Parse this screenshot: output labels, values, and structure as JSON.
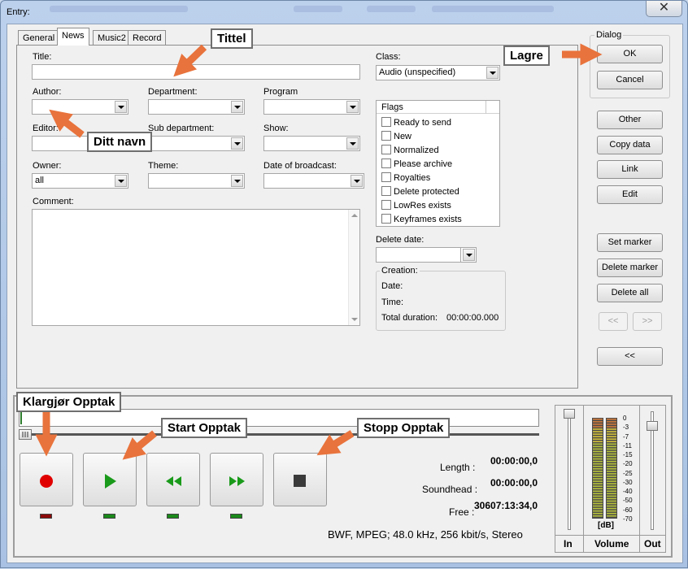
{
  "window": {
    "title": "Entry:",
    "close_symbol": "✕"
  },
  "tabs": [
    {
      "label": "General"
    },
    {
      "label": "News"
    },
    {
      "label": "Music2"
    },
    {
      "label": "Record"
    }
  ],
  "form": {
    "title_label": "Title:",
    "author_label": "Author:",
    "department_label": "Department:",
    "program_label": "Program",
    "editor_label": "Editor:",
    "sub_department_label": "Sub department:",
    "show_label": "Show:",
    "owner_label": "Owner:",
    "owner_value": "all",
    "theme_label": "Theme:",
    "date_of_broadcast_label": "Date of broadcast:",
    "comment_label": "Comment:",
    "class_label": "Class:",
    "class_value": "Audio (unspecified)",
    "flags_header": "Flags",
    "flags": [
      {
        "label": "Ready to send",
        "checked": false
      },
      {
        "label": "New",
        "checked": false
      },
      {
        "label": "Normalized",
        "checked": false
      },
      {
        "label": "Please archive",
        "checked": false
      },
      {
        "label": "Royalties",
        "checked": false
      },
      {
        "label": "Delete protected",
        "checked": false
      },
      {
        "label": "LowRes exists",
        "checked": false
      },
      {
        "label": "Keyframes exists",
        "checked": false
      }
    ],
    "delete_date_label": "Delete date:",
    "creation_title": "Creation:",
    "creation_date_label": "Date:",
    "creation_time_label": "Time:",
    "total_duration_label": "Total duration:",
    "total_duration_value": "00:00:00.000"
  },
  "dialog": {
    "group_title": "Dialog",
    "ok_label": "OK",
    "cancel_label": "Cancel"
  },
  "side_buttons": {
    "other": "Other",
    "copy_data": "Copy data",
    "link": "Link",
    "edit": "Edit",
    "set_marker": "Set marker",
    "delete_marker": "Delete marker",
    "delete_all": "Delete all",
    "prev": "<<",
    "next": ">>",
    "collapse": "<<"
  },
  "recorder": {
    "length_label": "Length :",
    "length_value": "00:00:00,0",
    "soundhead_label": "Soundhead :",
    "soundhead_value": "00:00:00,0",
    "free_label": "Free :",
    "free_value": "30607:13:34,0",
    "format": "BWF, MPEG; 48.0 kHz, 256 kbit/s, Stereo",
    "in_label": "In",
    "volume_label": "Volume",
    "out_label": "Out",
    "db_label": "[dB]",
    "db_scale": [
      "0",
      "-3",
      "-7",
      "-11",
      "-15",
      "-20",
      "-25",
      "-30",
      "-40",
      "-50",
      "-60",
      "-70"
    ],
    "buttons": [
      "record",
      "play",
      "rewind",
      "fast-forward",
      "stop"
    ],
    "colors": {
      "record": "#e00000",
      "play": "#1a9a1a",
      "led_record": "#8b0a0a",
      "led_green": "#1a8a1a"
    }
  },
  "annotations": {
    "tittel": "Tittel",
    "lagre": "Lagre",
    "ditt_navn": "Ditt navn",
    "klargjor": "Klargjør Opptak",
    "start": "Start Opptak",
    "stopp": "Stopp Opptak",
    "arrow_color": "#e8733c"
  }
}
